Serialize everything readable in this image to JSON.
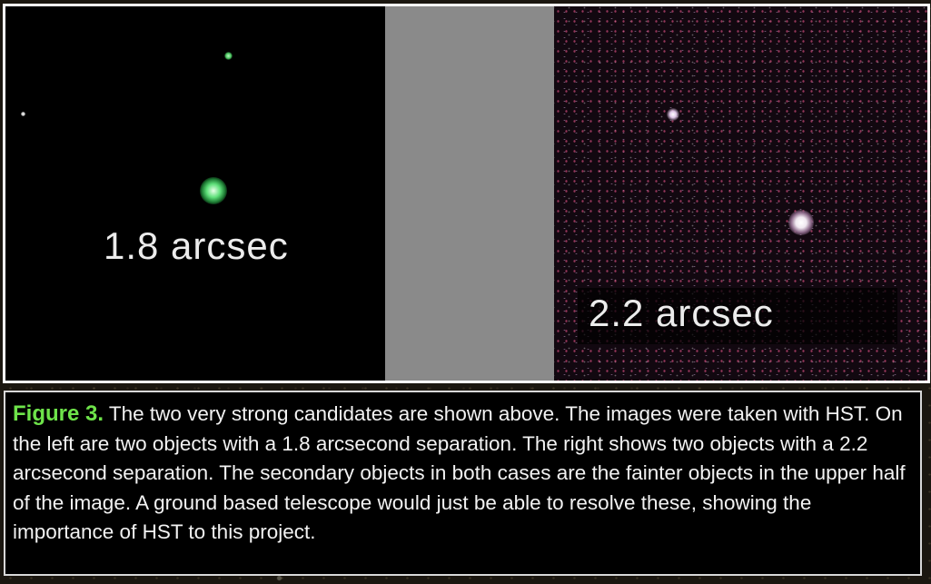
{
  "figure": {
    "left_panel": {
      "label": "1.8 arcsec",
      "star_colors": [
        "#5fe07a",
        "#ffffff"
      ]
    },
    "right_panel": {
      "label": "2.2 arcsec",
      "background_color": "#120810",
      "star_color": "#ffffff"
    },
    "divider_color": "#8a8a8a",
    "frame_color": "#ffffff"
  },
  "caption": {
    "lead": "Figure 3.",
    "text": " The two very strong candidates are shown above. The images were taken with HST. On the left are two objects with a 1.8 arcsecond separation. The right shows two objects with a 2.2 arcsecond separation. The secondary objects in both cases are the fainter objects in the upper half of the image. A ground based telescope would just be able to resolve these, showing the importance of HST to this project.",
    "lead_color": "#6ee34a"
  }
}
